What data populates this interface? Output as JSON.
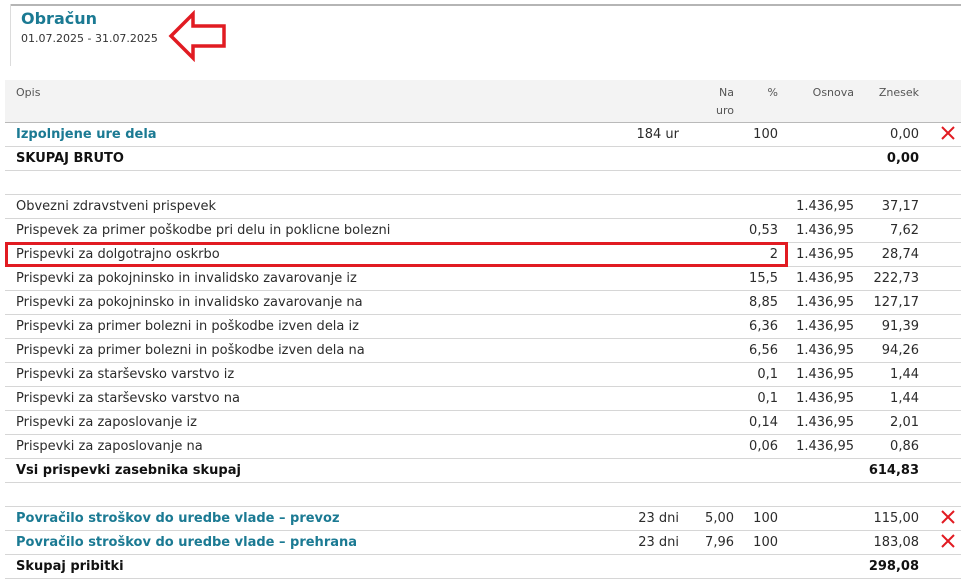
{
  "header": {
    "title": "Obračun",
    "period": "01.07.2025 - 31.07.2025"
  },
  "columns": {
    "desc": "Opis",
    "rate_line1": "Na",
    "rate_line2": "uro",
    "pct": "%",
    "base": "Osnova",
    "amount": "Znesek"
  },
  "colors": {
    "accent": "#1b7a93",
    "delete": "#e11b22",
    "annotation": "#e11b22"
  },
  "icons": {
    "delete": "close-icon",
    "annotation": "left-arrow-icon"
  },
  "rows": [
    {
      "desc": "Izpolnjene ure dela",
      "qty": "184 ur",
      "rate": "",
      "pct": "100",
      "base": "",
      "amount": "0,00"
    },
    {
      "desc": "SKUPAJ BRUTO",
      "qty": "",
      "rate": "",
      "pct": "",
      "base": "",
      "amount": "0,00"
    },
    {
      "desc": "",
      "qty": "",
      "rate": "",
      "pct": "",
      "base": "",
      "amount": ""
    },
    {
      "desc": "Obvezni zdravstveni prispevek",
      "qty": "",
      "rate": "",
      "pct": "",
      "base": "1.436,95",
      "amount": "37,17"
    },
    {
      "desc": "Prispevek za primer poškodbe pri delu in poklicne bolezni",
      "qty": "",
      "rate": "",
      "pct": "0,53",
      "base": "1.436,95",
      "amount": "7,62"
    },
    {
      "desc": "Prispevki za dolgotrajno oskrbo",
      "qty": "",
      "rate": "",
      "pct": "2",
      "base": "1.436,95",
      "amount": "28,74"
    },
    {
      "desc": "Prispevki za pokojninsko in invalidsko zavarovanje iz",
      "qty": "",
      "rate": "",
      "pct": "15,5",
      "base": "1.436,95",
      "amount": "222,73"
    },
    {
      "desc": "Prispevki za pokojninsko in invalidsko zavarovanje na",
      "qty": "",
      "rate": "",
      "pct": "8,85",
      "base": "1.436,95",
      "amount": "127,17"
    },
    {
      "desc": "Prispevki za primer bolezni in poškodbe izven dela iz",
      "qty": "",
      "rate": "",
      "pct": "6,36",
      "base": "1.436,95",
      "amount": "91,39"
    },
    {
      "desc": "Prispevki za primer bolezni in poškodbe izven dela na",
      "qty": "",
      "rate": "",
      "pct": "6,56",
      "base": "1.436,95",
      "amount": "94,26"
    },
    {
      "desc": "Prispevki za starševsko varstvo iz",
      "qty": "",
      "rate": "",
      "pct": "0,1",
      "base": "1.436,95",
      "amount": "1,44"
    },
    {
      "desc": "Prispevki za starševsko varstvo na",
      "qty": "",
      "rate": "",
      "pct": "0,1",
      "base": "1.436,95",
      "amount": "1,44"
    },
    {
      "desc": "Prispevki za zaposlovanje iz",
      "qty": "",
      "rate": "",
      "pct": "0,14",
      "base": "1.436,95",
      "amount": "2,01"
    },
    {
      "desc": "Prispevki za zaposlovanje na",
      "qty": "",
      "rate": "",
      "pct": "0,06",
      "base": "1.436,95",
      "amount": "0,86"
    },
    {
      "desc": "Vsi prispevki zasebnika skupaj",
      "qty": "",
      "rate": "",
      "pct": "",
      "base": "",
      "amount": "614,83"
    },
    {
      "desc": "",
      "qty": "",
      "rate": "",
      "pct": "",
      "base": "",
      "amount": ""
    },
    {
      "desc": "Povračilo stroškov do uredbe vlade – prevoz",
      "qty": "23 dni",
      "rate": "5,00",
      "pct": "100",
      "base": "",
      "amount": "115,00"
    },
    {
      "desc": "Povračilo stroškov do uredbe vlade – prehrana",
      "qty": "23 dni",
      "rate": "7,96",
      "pct": "100",
      "base": "",
      "amount": "183,08"
    },
    {
      "desc": "Skupaj pribitki",
      "qty": "",
      "rate": "",
      "pct": "",
      "base": "",
      "amount": "298,08"
    }
  ]
}
